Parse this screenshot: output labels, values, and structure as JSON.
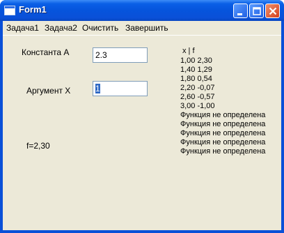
{
  "window": {
    "title": "Form1"
  },
  "menu": [
    "Задача1",
    "Задача2",
    "Очистить",
    "Завершить"
  ],
  "form": {
    "const_label": "Константа А",
    "const_value": "2.3",
    "arg_label": "Аргумент Х",
    "arg_value": "1",
    "result": "f=2,30"
  },
  "output": [
    " x | f",
    "1,00 2,30",
    "1,40 1,29",
    "1,80 0,54",
    "2,20 -0,07",
    "2,60 -0,57",
    "3,00 -1,00",
    "Функция не определена",
    "Функция не определена",
    "Функция не определена",
    "Функция не определена",
    "Функция не определена"
  ]
}
